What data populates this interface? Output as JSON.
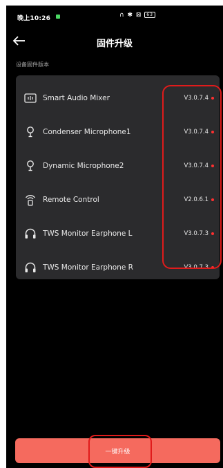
{
  "status_bar": {
    "time": "晚上10:26",
    "icons": "∩ ✱ ⊠ ",
    "battery": "63"
  },
  "header": {
    "title": "固件升级",
    "back_icon": "arrow-left-icon"
  },
  "section_label": "设备固件版本",
  "devices": [
    {
      "name": "Smart Audio Mixer",
      "version": "V3.0.7.4",
      "icon": "mixer-icon"
    },
    {
      "name": "Condenser Microphone1",
      "version": "V3.0.7.4",
      "icon": "microphone-icon"
    },
    {
      "name": "Dynamic Microphone2",
      "version": "V3.0.7.4",
      "icon": "microphone-icon"
    },
    {
      "name": "Remote Control",
      "version": "V2.0.6.1",
      "icon": "remote-control-icon"
    },
    {
      "name": "TWS Monitor Earphone L",
      "version": "V3.0.7.3",
      "icon": "headphones-icon"
    },
    {
      "name": "TWS Monitor Earphone R",
      "version": "V3.0.7.3",
      "icon": "headphones-icon"
    }
  ],
  "upgrade_button": "一键升级",
  "colors": {
    "background": "#000000",
    "card": "#2b2b2d",
    "accent": "#f56a5e",
    "update_dot": "#ff3030",
    "annotation": "#e01b1b"
  }
}
